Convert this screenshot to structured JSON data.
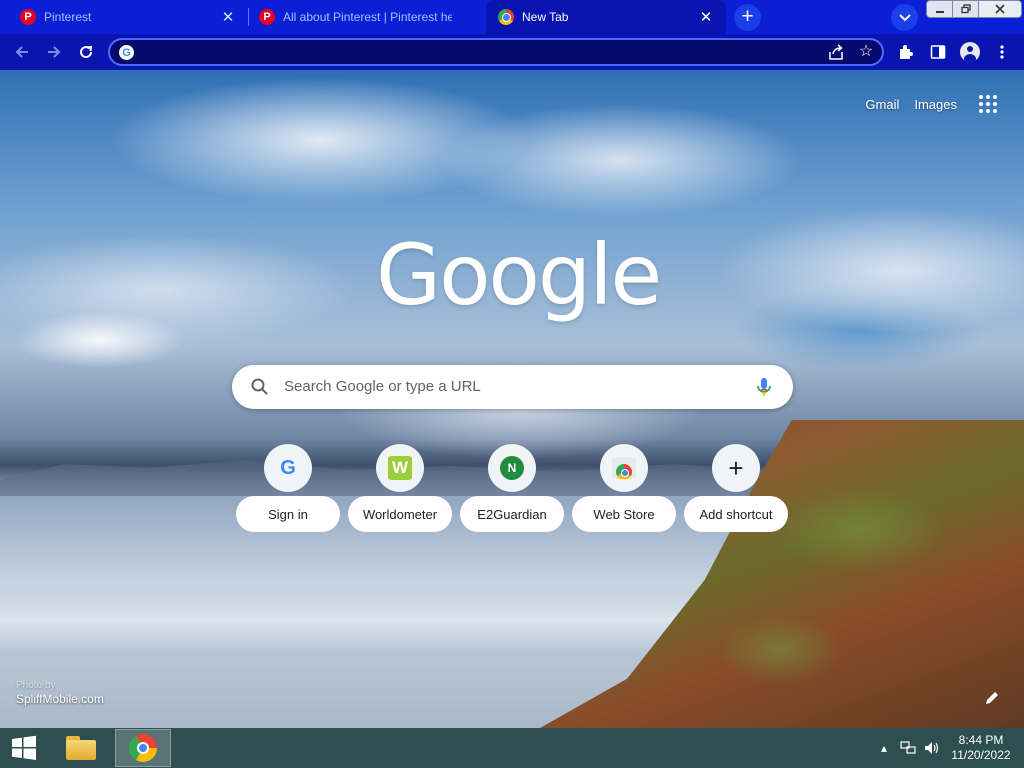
{
  "tabs": [
    {
      "title": "Pinterest",
      "favicon": "pinterest-icon"
    },
    {
      "title": "All about Pinterest | Pinterest hel",
      "favicon": "pinterest-icon"
    },
    {
      "title": "New Tab",
      "favicon": "chrome-icon",
      "active": true
    }
  ],
  "window_controls": {
    "minimize": "minimize-icon",
    "maximize": "restore-icon",
    "close": "close-icon"
  },
  "toolbar": {
    "omnibox_value": "",
    "icons": [
      "back-arrow-icon",
      "forward-arrow-icon",
      "reload-icon",
      "share-icon",
      "star-icon",
      "extensions-icon",
      "side-panel-icon",
      "profile-avatar-icon",
      "menu-dots-icon"
    ]
  },
  "ntp": {
    "gmail": "Gmail",
    "images": "Images",
    "logo": "Google",
    "search_placeholder": "Search Google or type a URL",
    "shortcuts": [
      {
        "label": "Sign in",
        "icon": "google-g-icon"
      },
      {
        "label": "Worldometer",
        "icon": "worldometer-icon"
      },
      {
        "label": "E2Guardian",
        "icon": "n-letter-icon"
      },
      {
        "label": "Web Store",
        "icon": "chrome-web-store-icon"
      },
      {
        "label": "Add shortcut",
        "icon": "plus-icon"
      }
    ],
    "background_credit_small": "Photo by",
    "background_credit": "SpliffMobile.com"
  },
  "taskbar": {
    "time": "8:44 PM",
    "date": "11/20/2022",
    "apps": [
      "file-explorer-icon",
      "chrome-icon"
    ]
  },
  "colors": {
    "tab_strip": "#0a1fd6",
    "toolbar": "#0a14b0",
    "omnibox": "#050a6e",
    "taskbar": "#2d4f4f"
  }
}
